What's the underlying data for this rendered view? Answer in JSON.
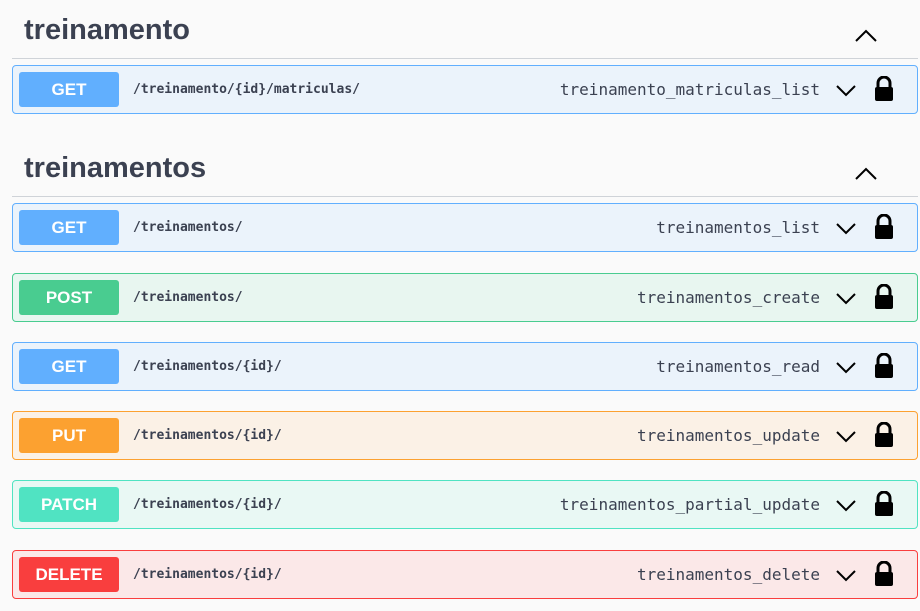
{
  "sections": [
    {
      "title": "treinamento",
      "toggle_icon": "chevron-up-icon"
    },
    {
      "title": "treinamentos",
      "toggle_icon": "chevron-up-icon"
    }
  ],
  "operations": [
    {
      "method": "GET",
      "path": "/treinamento/{id}/matriculas/",
      "operation_id": "treinamento_matriculas_list",
      "color": "#61affe",
      "bg": "#ebf3fb"
    },
    {
      "method": "GET",
      "path": "/treinamentos/",
      "operation_id": "treinamentos_list",
      "color": "#61affe",
      "bg": "#ebf3fb"
    },
    {
      "method": "POST",
      "path": "/treinamentos/",
      "operation_id": "treinamentos_create",
      "color": "#49cc90",
      "bg": "#e8f6f0"
    },
    {
      "method": "GET",
      "path": "/treinamentos/{id}/",
      "operation_id": "treinamentos_read",
      "color": "#61affe",
      "bg": "#ebf3fb"
    },
    {
      "method": "PUT",
      "path": "/treinamentos/{id}/",
      "operation_id": "treinamentos_update",
      "color": "#fca130",
      "bg": "#fbf1e6"
    },
    {
      "method": "PATCH",
      "path": "/treinamentos/{id}/",
      "operation_id": "treinamentos_partial_update",
      "color": "#50e3c2",
      "bg": "#e9f8f4"
    },
    {
      "method": "DELETE",
      "path": "/treinamentos/{id}/",
      "operation_id": "treinamentos_delete",
      "color": "#f93e3e",
      "bg": "#fbe8e8"
    }
  ],
  "icons": {
    "expand": "chevron-down-icon",
    "auth": "lock-icon"
  }
}
